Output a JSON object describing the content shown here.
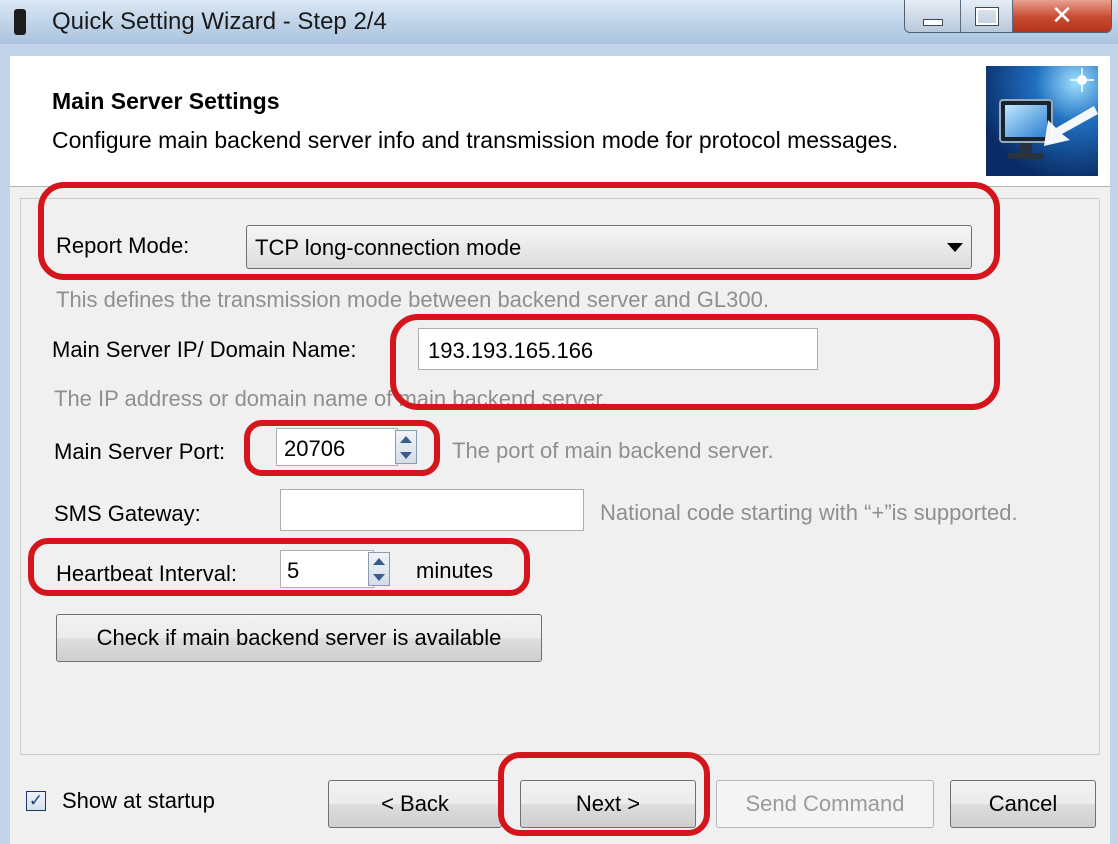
{
  "window": {
    "title": "Quick Setting Wizard - Step 2/4",
    "close_glyph": "✕"
  },
  "header": {
    "title": "Main Server Settings",
    "subtitle": "Configure main backend server info and transmission mode for protocol messages."
  },
  "report_mode": {
    "label": "Report Mode:",
    "value": "TCP long-connection mode",
    "hint": "This defines the transmission mode between backend server and GL300."
  },
  "server_ip": {
    "label": "Main Server IP/ Domain Name:",
    "value": "193.193.165.166",
    "hint": "The IP address or domain name of main backend server."
  },
  "server_port": {
    "label": "Main Server Port:",
    "value": "20706",
    "hint": "The port of main backend server."
  },
  "sms_gateway": {
    "label": "SMS Gateway:",
    "value": "",
    "hint": "National code starting with “+”is supported."
  },
  "heartbeat": {
    "label": "Heartbeat Interval:",
    "value": "5",
    "unit": "minutes"
  },
  "check_button": "Check if main backend server is available",
  "footer": {
    "show_at_startup": "Show at startup",
    "show_at_startup_checked": true,
    "checkmark": "✓",
    "back": "< Back",
    "next": "Next >",
    "send": "Send Command",
    "cancel": "Cancel"
  },
  "colors": {
    "highlight": "#d4151b",
    "titlebar": "#c3d6ea"
  }
}
